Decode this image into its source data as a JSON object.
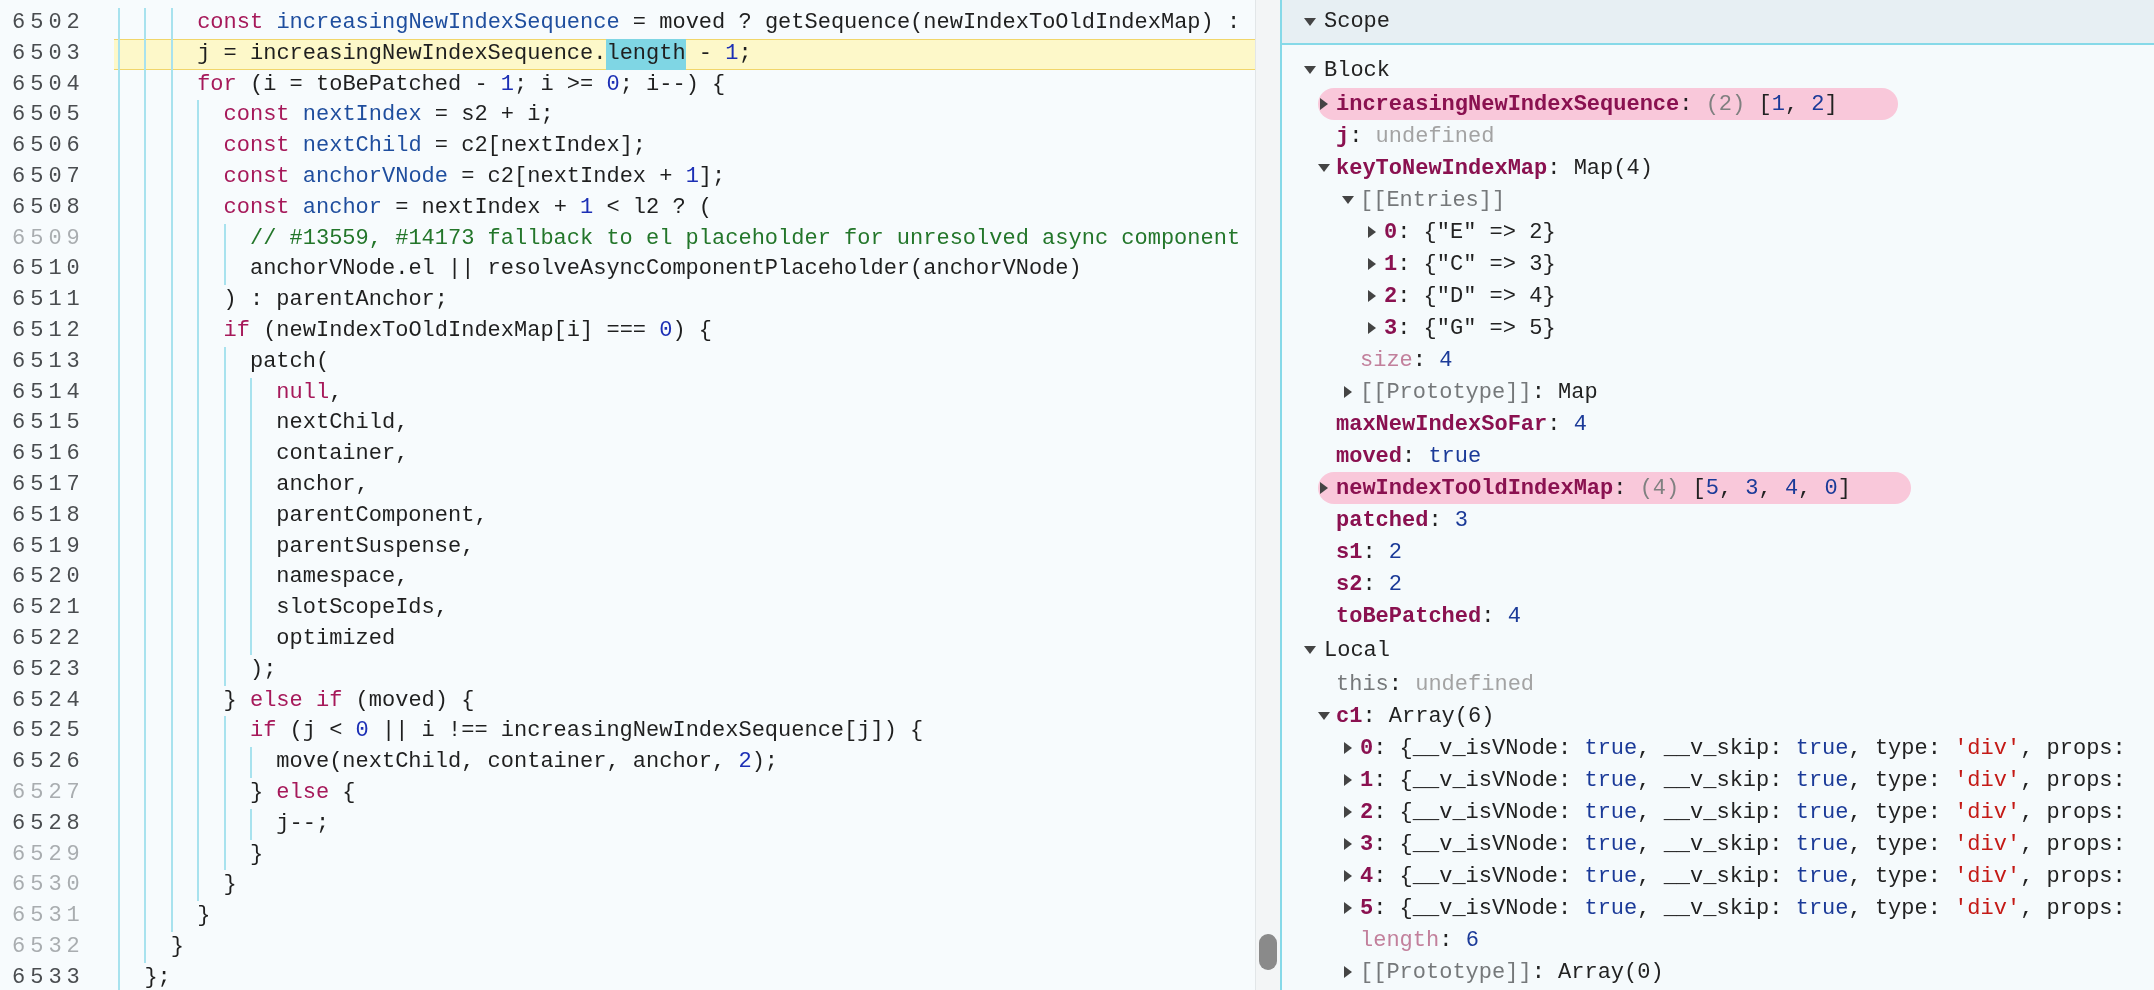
{
  "editor": {
    "lines": [
      {
        "number": "6502",
        "dimmed": false,
        "current": false,
        "segments": [
          {
            "text": "      const ",
            "kind": "keyword"
          },
          {
            "text": "increasingNewIndexSequence",
            "kind": "name"
          },
          {
            "text": " = moved ? getSequence(newIndexToOldIndexMap) :",
            "kind": "plain"
          }
        ]
      },
      {
        "number": "6503",
        "dimmed": false,
        "current": true,
        "segments": [
          {
            "text": "      j = increasingNewIndexSequence.",
            "kind": "plain"
          },
          {
            "text": "length",
            "kind": "match"
          },
          {
            "text": " - ",
            "kind": "plain"
          },
          {
            "text": "1",
            "kind": "number"
          },
          {
            "text": ";",
            "kind": "plain"
          }
        ]
      },
      {
        "number": "6504",
        "dimmed": false,
        "current": false,
        "segments": [
          {
            "text": "      for",
            "kind": "keyword"
          },
          {
            "text": " (i = toBePatched - ",
            "kind": "plain"
          },
          {
            "text": "1",
            "kind": "number"
          },
          {
            "text": "; i >= ",
            "kind": "plain"
          },
          {
            "text": "0",
            "kind": "number"
          },
          {
            "text": "; i--) {",
            "kind": "plain"
          }
        ]
      },
      {
        "number": "6505",
        "dimmed": false,
        "current": false,
        "segments": [
          {
            "text": "        const ",
            "kind": "keyword"
          },
          {
            "text": "nextIndex",
            "kind": "name"
          },
          {
            "text": " = s2 + i;",
            "kind": "plain"
          }
        ]
      },
      {
        "number": "6506",
        "dimmed": false,
        "current": false,
        "segments": [
          {
            "text": "        const ",
            "kind": "keyword"
          },
          {
            "text": "nextChild",
            "kind": "name"
          },
          {
            "text": " = c2[nextIndex];",
            "kind": "plain"
          }
        ]
      },
      {
        "number": "6507",
        "dimmed": false,
        "current": false,
        "segments": [
          {
            "text": "        const ",
            "kind": "keyword"
          },
          {
            "text": "anchorVNode",
            "kind": "name"
          },
          {
            "text": " = c2[nextIndex + ",
            "kind": "plain"
          },
          {
            "text": "1",
            "kind": "number"
          },
          {
            "text": "];",
            "kind": "plain"
          }
        ]
      },
      {
        "number": "6508",
        "dimmed": false,
        "current": false,
        "segments": [
          {
            "text": "        const ",
            "kind": "keyword"
          },
          {
            "text": "anchor",
            "kind": "name"
          },
          {
            "text": " = nextIndex + ",
            "kind": "plain"
          },
          {
            "text": "1",
            "kind": "number"
          },
          {
            "text": " < l2 ? (",
            "kind": "plain"
          }
        ]
      },
      {
        "number": "6509",
        "dimmed": true,
        "current": false,
        "segments": [
          {
            "text": "          // #13559, #14173 fallback to el placeholder for unresolved async component",
            "kind": "comment"
          }
        ]
      },
      {
        "number": "6510",
        "dimmed": false,
        "current": false,
        "segments": [
          {
            "text": "          anchorVNode.el || resolveAsyncComponentPlaceholder(anchorVNode)",
            "kind": "plain"
          }
        ]
      },
      {
        "number": "6511",
        "dimmed": false,
        "current": false,
        "segments": [
          {
            "text": "        ) : parentAnchor;",
            "kind": "plain"
          }
        ]
      },
      {
        "number": "6512",
        "dimmed": false,
        "current": false,
        "segments": [
          {
            "text": "        if",
            "kind": "keyword"
          },
          {
            "text": " (newIndexToOldIndexMap[i] === ",
            "kind": "plain"
          },
          {
            "text": "0",
            "kind": "number"
          },
          {
            "text": ") {",
            "kind": "plain"
          }
        ]
      },
      {
        "number": "6513",
        "dimmed": false,
        "current": false,
        "segments": [
          {
            "text": "          patch(",
            "kind": "plain"
          }
        ]
      },
      {
        "number": "6514",
        "dimmed": false,
        "current": false,
        "segments": [
          {
            "text": "            null",
            "kind": "keyword"
          },
          {
            "text": ",",
            "kind": "plain"
          }
        ]
      },
      {
        "number": "6515",
        "dimmed": false,
        "current": false,
        "segments": [
          {
            "text": "            nextChild,",
            "kind": "plain"
          }
        ]
      },
      {
        "number": "6516",
        "dimmed": false,
        "current": false,
        "segments": [
          {
            "text": "            container,",
            "kind": "plain"
          }
        ]
      },
      {
        "number": "6517",
        "dimmed": false,
        "current": false,
        "segments": [
          {
            "text": "            anchor,",
            "kind": "plain"
          }
        ]
      },
      {
        "number": "6518",
        "dimmed": false,
        "current": false,
        "segments": [
          {
            "text": "            parentComponent,",
            "kind": "plain"
          }
        ]
      },
      {
        "number": "6519",
        "dimmed": false,
        "current": false,
        "segments": [
          {
            "text": "            parentSuspense,",
            "kind": "plain"
          }
        ]
      },
      {
        "number": "6520",
        "dimmed": false,
        "current": false,
        "segments": [
          {
            "text": "            namespace,",
            "kind": "plain"
          }
        ]
      },
      {
        "number": "6521",
        "dimmed": false,
        "current": false,
        "segments": [
          {
            "text": "            slotScopeIds,",
            "kind": "plain"
          }
        ]
      },
      {
        "number": "6522",
        "dimmed": false,
        "current": false,
        "segments": [
          {
            "text": "            optimized",
            "kind": "plain"
          }
        ]
      },
      {
        "number": "6523",
        "dimmed": false,
        "current": false,
        "segments": [
          {
            "text": "          );",
            "kind": "plain"
          }
        ]
      },
      {
        "number": "6524",
        "dimmed": false,
        "current": false,
        "segments": [
          {
            "text": "        } ",
            "kind": "plain"
          },
          {
            "text": "else if",
            "kind": "keyword"
          },
          {
            "text": " (moved) {",
            "kind": "plain"
          }
        ]
      },
      {
        "number": "6525",
        "dimmed": false,
        "current": false,
        "segments": [
          {
            "text": "          if",
            "kind": "keyword"
          },
          {
            "text": " (j < ",
            "kind": "plain"
          },
          {
            "text": "0",
            "kind": "number"
          },
          {
            "text": " || i !== increasingNewIndexSequence[j]) {",
            "kind": "plain"
          }
        ]
      },
      {
        "number": "6526",
        "dimmed": false,
        "current": false,
        "segments": [
          {
            "text": "            move(nextChild, container, anchor, ",
            "kind": "plain"
          },
          {
            "text": "2",
            "kind": "number"
          },
          {
            "text": ");",
            "kind": "plain"
          }
        ]
      },
      {
        "number": "6527",
        "dimmed": true,
        "current": false,
        "segments": [
          {
            "text": "          } ",
            "kind": "plain"
          },
          {
            "text": "else",
            "kind": "keyword"
          },
          {
            "text": " {",
            "kind": "plain"
          }
        ]
      },
      {
        "number": "6528",
        "dimmed": false,
        "current": false,
        "segments": [
          {
            "text": "            j--;",
            "kind": "plain"
          }
        ]
      },
      {
        "number": "6529",
        "dimmed": true,
        "current": false,
        "segments": [
          {
            "text": "          }",
            "kind": "plain"
          }
        ]
      },
      {
        "number": "6530",
        "dimmed": true,
        "current": false,
        "segments": [
          {
            "text": "        }",
            "kind": "plain"
          }
        ]
      },
      {
        "number": "6531",
        "dimmed": true,
        "current": false,
        "segments": [
          {
            "text": "      }",
            "kind": "plain"
          }
        ]
      },
      {
        "number": "6532",
        "dimmed": true,
        "current": false,
        "segments": [
          {
            "text": "    }",
            "kind": "plain"
          }
        ]
      },
      {
        "number": "6533",
        "dimmed": false,
        "current": false,
        "segments": [
          {
            "text": "  };",
            "kind": "plain"
          }
        ]
      }
    ]
  },
  "scope": {
    "title": "Scope",
    "expanded": true,
    "sections": [
      {
        "title": "Block",
        "expanded": true,
        "items": [
          {
            "key": "increasingNewIndexSequence",
            "kind": "own",
            "expanded": false,
            "highlighted": true,
            "value": [
              {
                "text": ": ",
                "kind": "plain"
              },
              {
                "text": "(2)",
                "kind": "count"
              },
              {
                "text": " [",
                "kind": "plain"
              },
              {
                "text": "1",
                "kind": "number"
              },
              {
                "text": ", ",
                "kind": "plain"
              },
              {
                "text": "2",
                "kind": "number"
              },
              {
                "text": "]",
                "kind": "plain"
              }
            ]
          },
          {
            "key": "j",
            "kind": "own",
            "highlighted": false,
            "value": [
              {
                "text": ": ",
                "kind": "plain"
              },
              {
                "text": "undefined",
                "kind": "undefined"
              }
            ]
          },
          {
            "key": "keyToNewIndexMap",
            "kind": "own",
            "expanded": true,
            "highlighted": false,
            "value": [
              {
                "text": ": Map(4)",
                "kind": "plain"
              }
            ],
            "children": [
              {
                "key": "[[Entries]]",
                "kind": "meta",
                "expanded": true,
                "children": [
                  {
                    "key": "0",
                    "kind": "own",
                    "expanded": false,
                    "value": [
                      {
                        "text": ": {\"E\" => 2}",
                        "kind": "plain"
                      }
                    ]
                  },
                  {
                    "key": "1",
                    "kind": "own",
                    "expanded": false,
                    "value": [
                      {
                        "text": ": {\"C\" => 3}",
                        "kind": "plain"
                      }
                    ]
                  },
                  {
                    "key": "2",
                    "kind": "own",
                    "expanded": false,
                    "value": [
                      {
                        "text": ": {\"D\" => 4}",
                        "kind": "plain"
                      }
                    ]
                  },
                  {
                    "key": "3",
                    "kind": "own",
                    "expanded": false,
                    "value": [
                      {
                        "text": ": {\"G\" => 5}",
                        "kind": "plain"
                      }
                    ]
                  }
                ]
              },
              {
                "key": "size",
                "kind": "internal",
                "value": [
                  {
                    "text": ": ",
                    "kind": "plain"
                  },
                  {
                    "text": "4",
                    "kind": "number"
                  }
                ]
              },
              {
                "key": "[[Prototype]]",
                "kind": "meta",
                "expanded": false,
                "value": [
                  {
                    "text": ": Map",
                    "kind": "plain"
                  }
                ]
              }
            ]
          },
          {
            "key": "maxNewIndexSoFar",
            "kind": "own",
            "highlighted": false,
            "value": [
              {
                "text": ": ",
                "kind": "plain"
              },
              {
                "text": "4",
                "kind": "number"
              }
            ]
          },
          {
            "key": "moved",
            "kind": "own",
            "highlighted": false,
            "value": [
              {
                "text": ": ",
                "kind": "plain"
              },
              {
                "text": "true",
                "kind": "number"
              }
            ]
          },
          {
            "key": "newIndexToOldIndexMap",
            "kind": "own",
            "expanded": false,
            "highlighted": true,
            "value": [
              {
                "text": ": ",
                "kind": "plain"
              },
              {
                "text": "(4)",
                "kind": "count"
              },
              {
                "text": " [",
                "kind": "plain"
              },
              {
                "text": "5",
                "kind": "number"
              },
              {
                "text": ", ",
                "kind": "plain"
              },
              {
                "text": "3",
                "kind": "number"
              },
              {
                "text": ", ",
                "kind": "plain"
              },
              {
                "text": "4",
                "kind": "number"
              },
              {
                "text": ", ",
                "kind": "plain"
              },
              {
                "text": "0",
                "kind": "number"
              },
              {
                "text": "]",
                "kind": "plain"
              }
            ]
          },
          {
            "key": "patched",
            "kind": "own",
            "highlighted": false,
            "value": [
              {
                "text": ": ",
                "kind": "plain"
              },
              {
                "text": "3",
                "kind": "number"
              }
            ]
          },
          {
            "key": "s1",
            "kind": "own",
            "highlighted": false,
            "value": [
              {
                "text": ": ",
                "kind": "plain"
              },
              {
                "text": "2",
                "kind": "number"
              }
            ]
          },
          {
            "key": "s2",
            "kind": "own",
            "highlighted": false,
            "value": [
              {
                "text": ": ",
                "kind": "plain"
              },
              {
                "text": "2",
                "kind": "number"
              }
            ]
          },
          {
            "key": "toBePatched",
            "kind": "own",
            "highlighted": false,
            "value": [
              {
                "text": ": ",
                "kind": "plain"
              },
              {
                "text": "4",
                "kind": "number"
              }
            ]
          }
        ]
      },
      {
        "title": "Local",
        "expanded": true,
        "items": [
          {
            "key": "this",
            "kind": "meta",
            "highlighted": false,
            "value": [
              {
                "text": ": ",
                "kind": "plain"
              },
              {
                "text": "undefined",
                "kind": "undefined"
              }
            ]
          },
          {
            "key": "c1",
            "kind": "own",
            "expanded": true,
            "highlighted": false,
            "value": [
              {
                "text": ": Array(6)",
                "kind": "plain"
              }
            ],
            "children": [
              {
                "key": "0",
                "kind": "own",
                "expanded": false,
                "value": [
                  {
                    "text": ": {__v_isVNode: ",
                    "kind": "plain"
                  },
                  {
                    "text": "true",
                    "kind": "number"
                  },
                  {
                    "text": ", __v_skip: ",
                    "kind": "plain"
                  },
                  {
                    "text": "true",
                    "kind": "number"
                  },
                  {
                    "text": ", type: ",
                    "kind": "plain"
                  },
                  {
                    "text": "'div'",
                    "kind": "string"
                  },
                  {
                    "text": ", props:",
                    "kind": "plain"
                  }
                ]
              },
              {
                "key": "1",
                "kind": "own",
                "expanded": false,
                "value": [
                  {
                    "text": ": {__v_isVNode: ",
                    "kind": "plain"
                  },
                  {
                    "text": "true",
                    "kind": "number"
                  },
                  {
                    "text": ", __v_skip: ",
                    "kind": "plain"
                  },
                  {
                    "text": "true",
                    "kind": "number"
                  },
                  {
                    "text": ", type: ",
                    "kind": "plain"
                  },
                  {
                    "text": "'div'",
                    "kind": "string"
                  },
                  {
                    "text": ", props:",
                    "kind": "plain"
                  }
                ]
              },
              {
                "key": "2",
                "kind": "own",
                "expanded": false,
                "value": [
                  {
                    "text": ": {__v_isVNode: ",
                    "kind": "plain"
                  },
                  {
                    "text": "true",
                    "kind": "number"
                  },
                  {
                    "text": ", __v_skip: ",
                    "kind": "plain"
                  },
                  {
                    "text": "true",
                    "kind": "number"
                  },
                  {
                    "text": ", type: ",
                    "kind": "plain"
                  },
                  {
                    "text": "'div'",
                    "kind": "string"
                  },
                  {
                    "text": ", props:",
                    "kind": "plain"
                  }
                ]
              },
              {
                "key": "3",
                "kind": "own",
                "expanded": false,
                "value": [
                  {
                    "text": ": {__v_isVNode: ",
                    "kind": "plain"
                  },
                  {
                    "text": "true",
                    "kind": "number"
                  },
                  {
                    "text": ", __v_skip: ",
                    "kind": "plain"
                  },
                  {
                    "text": "true",
                    "kind": "number"
                  },
                  {
                    "text": ", type: ",
                    "kind": "plain"
                  },
                  {
                    "text": "'div'",
                    "kind": "string"
                  },
                  {
                    "text": ", props:",
                    "kind": "plain"
                  }
                ]
              },
              {
                "key": "4",
                "kind": "own",
                "expanded": false,
                "value": [
                  {
                    "text": ": {__v_isVNode: ",
                    "kind": "plain"
                  },
                  {
                    "text": "true",
                    "kind": "number"
                  },
                  {
                    "text": ", __v_skip: ",
                    "kind": "plain"
                  },
                  {
                    "text": "true",
                    "kind": "number"
                  },
                  {
                    "text": ", type: ",
                    "kind": "plain"
                  },
                  {
                    "text": "'div'",
                    "kind": "string"
                  },
                  {
                    "text": ", props:",
                    "kind": "plain"
                  }
                ]
              },
              {
                "key": "5",
                "kind": "own",
                "expanded": false,
                "value": [
                  {
                    "text": ": {__v_isVNode: ",
                    "kind": "plain"
                  },
                  {
                    "text": "true",
                    "kind": "number"
                  },
                  {
                    "text": ", __v_skip: ",
                    "kind": "plain"
                  },
                  {
                    "text": "true",
                    "kind": "number"
                  },
                  {
                    "text": ", type: ",
                    "kind": "plain"
                  },
                  {
                    "text": "'div'",
                    "kind": "string"
                  },
                  {
                    "text": ", props:",
                    "kind": "plain"
                  }
                ]
              },
              {
                "key": "length",
                "kind": "internal",
                "value": [
                  {
                    "text": ": ",
                    "kind": "plain"
                  },
                  {
                    "text": "6",
                    "kind": "number"
                  }
                ]
              },
              {
                "key": "[[Prototype]]",
                "kind": "meta",
                "expanded": false,
                "value": [
                  {
                    "text": ": Array(0)",
                    "kind": "plain"
                  }
                ]
              }
            ]
          }
        ]
      }
    ]
  }
}
